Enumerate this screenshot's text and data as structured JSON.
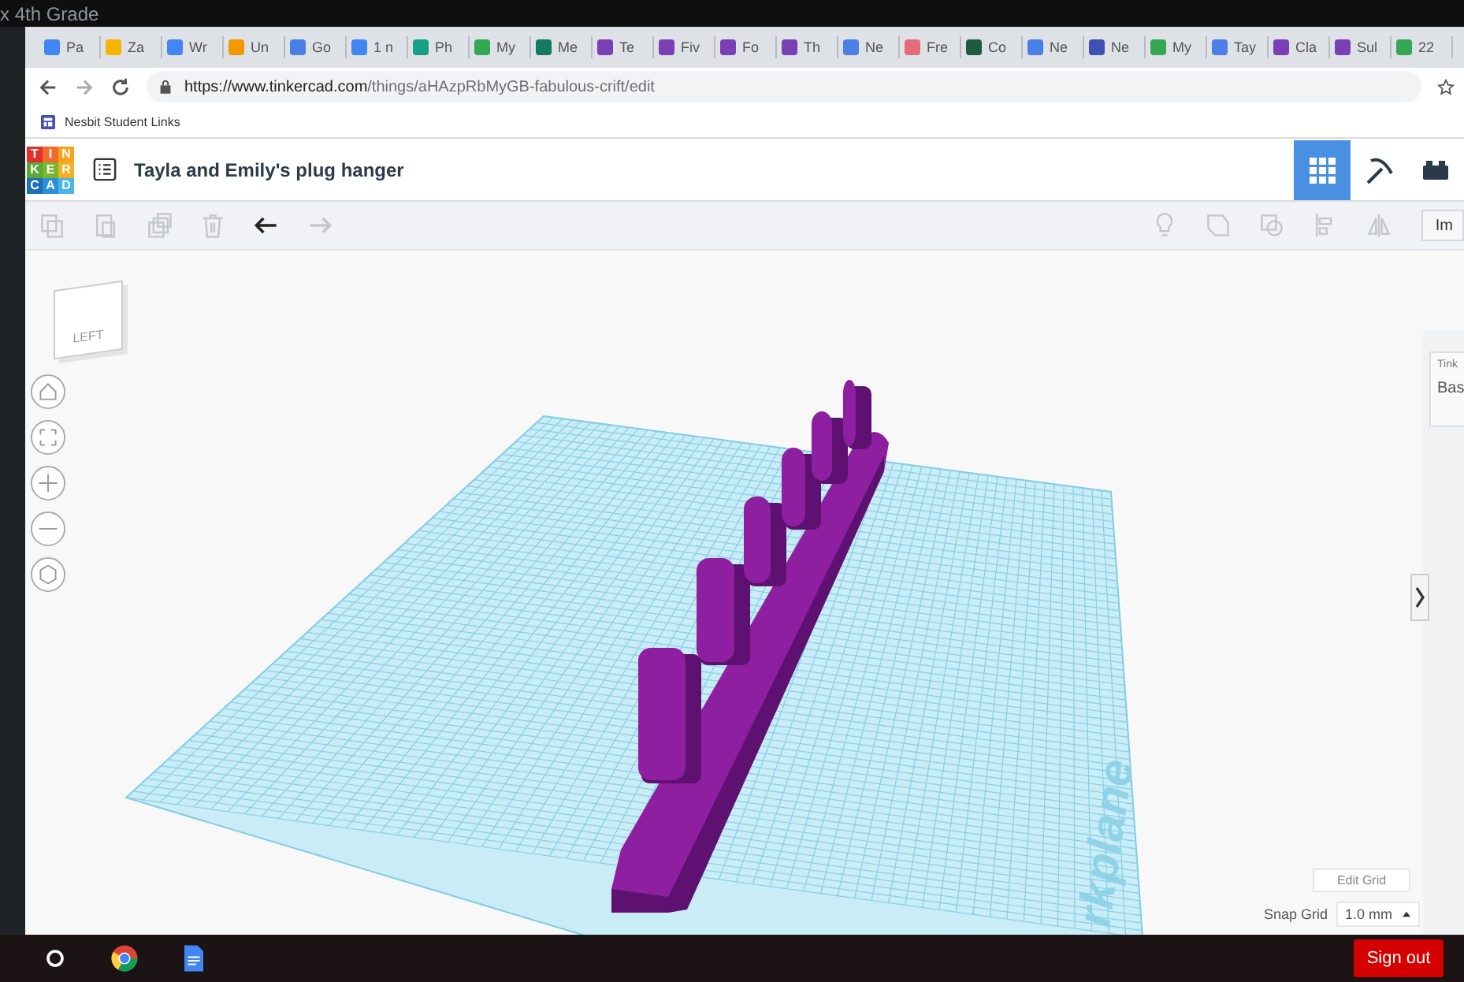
{
  "os_title": "x 4th Grade",
  "tabs": [
    {
      "label": "Pa",
      "color": "#4285f4"
    },
    {
      "label": "Za",
      "color": "#f4b400"
    },
    {
      "label": "Wr",
      "color": "#4285f4"
    },
    {
      "label": "Un",
      "color": "#f29900"
    },
    {
      "label": "Go",
      "color": "#4a7fe8"
    },
    {
      "label": "1 n",
      "color": "#4285f4"
    },
    {
      "label": "Ph",
      "color": "#16a085"
    },
    {
      "label": "My",
      "color": "#34a853"
    },
    {
      "label": "Me",
      "color": "#137a5f"
    },
    {
      "label": "Te",
      "color": "#7b3fb5"
    },
    {
      "label": "Fiv",
      "color": "#7b3fb5"
    },
    {
      "label": "Fo",
      "color": "#7b3fb5"
    },
    {
      "label": "Th",
      "color": "#7b3fb5"
    },
    {
      "label": "Ne",
      "color": "#4a7fe8"
    },
    {
      "label": "Fre",
      "color": "#e56b7a"
    },
    {
      "label": "Co",
      "color": "#1e5b3e"
    },
    {
      "label": "Ne",
      "color": "#4a7fe8"
    },
    {
      "label": "Ne",
      "color": "#3f51b5"
    },
    {
      "label": "My",
      "color": "#34a853"
    },
    {
      "label": "Tay",
      "color": "#4a7fe8"
    },
    {
      "label": "Cla",
      "color": "#7b3fb5"
    },
    {
      "label": "Sul",
      "color": "#7b3fb5"
    },
    {
      "label": "22",
      "color": "#34a853"
    }
  ],
  "address_bar": {
    "url_host": "https://www.tinkercad.com",
    "url_path": "/things/aHAzpRbMyGB-fabulous-crift/edit"
  },
  "bookmarks": [
    {
      "label": "Nesbit Student Links"
    }
  ],
  "app_header": {
    "logo": [
      {
        "letter": "T",
        "color": "#e2312d"
      },
      {
        "letter": "I",
        "color": "#f26a2e"
      },
      {
        "letter": "N",
        "color": "#f7a21b"
      },
      {
        "letter": "K",
        "color": "#5aa83a"
      },
      {
        "letter": "E",
        "color": "#76b82a"
      },
      {
        "letter": "R",
        "color": "#f2b01e"
      },
      {
        "letter": "C",
        "color": "#1f6fb5"
      },
      {
        "letter": "A",
        "color": "#2a8fd6"
      },
      {
        "letter": "D",
        "color": "#48b5e6"
      }
    ],
    "title": "Tayla and Emily's plug hanger",
    "view_modes": [
      {
        "kind": "grid",
        "selected": true
      },
      {
        "kind": "pickaxe",
        "selected": false
      },
      {
        "kind": "bricks",
        "selected": false
      }
    ]
  },
  "toolbar": {
    "left_tools": [
      {
        "kind": "copy",
        "disabled": true
      },
      {
        "kind": "paste",
        "disabled": true
      },
      {
        "kind": "duplicate",
        "disabled": true
      },
      {
        "kind": "delete",
        "disabled": true
      },
      {
        "kind": "undo",
        "disabled": false
      },
      {
        "kind": "redo",
        "disabled": true
      }
    ],
    "right_tools": [
      {
        "kind": "bulb",
        "disabled": true
      },
      {
        "kind": "tag",
        "disabled": true
      },
      {
        "kind": "cutout",
        "disabled": true
      },
      {
        "kind": "align",
        "disabled": true
      },
      {
        "kind": "mirror",
        "disabled": true
      }
    ],
    "import_button": "Im"
  },
  "view_cube": {
    "label": "LEFT"
  },
  "workplane_label": "rkplane",
  "side_panel": {
    "caption": "Tink",
    "value": "Bas"
  },
  "edit_grid_button": "Edit Grid",
  "snap_grid": {
    "label": "Snap Grid",
    "value": "1.0 mm"
  },
  "taskbar": {
    "sign_out": "Sign out"
  }
}
